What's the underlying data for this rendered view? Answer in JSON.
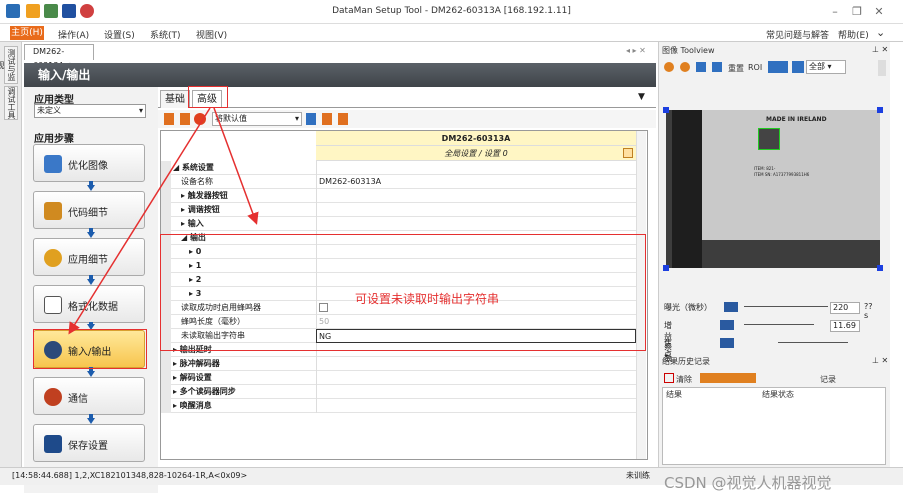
{
  "window": {
    "title": "DataMan Setup Tool - DM262-60313A [168.192.1.11]"
  },
  "menu": {
    "main": "主页(H)",
    "items": [
      "操作(A)",
      "设置(S)",
      "系统(T)",
      "视图(V)"
    ],
    "right": [
      "常见问题与解答",
      "帮助(E)"
    ]
  },
  "vtabs": [
    "测试与监视",
    "调试工具"
  ],
  "doc_tab": "DM262-60313A",
  "header": "输入/输出",
  "left": {
    "app_type_label": "应用类型",
    "app_type_value": "未定义",
    "steps_label": "应用步骤",
    "steps": [
      "优化图像",
      "代码细节",
      "应用细节",
      "格式化数据",
      "输入/输出",
      "通信",
      "保存设置"
    ]
  },
  "subtabs": [
    "基础",
    "高级"
  ],
  "toolbar": {
    "default_label": "将默认值"
  },
  "grid": {
    "device": "DM262-60313A",
    "settings_label": "全局设置 / 设置 0",
    "rows": [
      {
        "name": "系统设置",
        "value": "",
        "cat": true,
        "level": 0
      },
      {
        "name": "设备名称",
        "value": "DM262-60313A",
        "cat": false,
        "level": 1
      },
      {
        "name": "触发器按钮",
        "value": "",
        "cat": true,
        "level": 1
      },
      {
        "name": "调谐按钮",
        "value": "",
        "cat": true,
        "level": 1
      },
      {
        "name": "输入",
        "value": "",
        "cat": true,
        "level": 1
      },
      {
        "name": "输出",
        "value": "",
        "cat": true,
        "level": 1
      },
      {
        "name": "0",
        "value": "",
        "cat": true,
        "level": 2
      },
      {
        "name": "1",
        "value": "",
        "cat": true,
        "level": 2
      },
      {
        "name": "2",
        "value": "",
        "cat": true,
        "level": 2
      },
      {
        "name": "3",
        "value": "",
        "cat": true,
        "level": 2
      },
      {
        "name": "读取成功时启用蜂鸣器",
        "value": "",
        "cat": false,
        "level": 1
      },
      {
        "name": "蜂鸣长度（毫秒）",
        "value": "50",
        "cat": false,
        "level": 1
      },
      {
        "name": "未读取输出字符串",
        "value": "NG",
        "cat": false,
        "level": 1
      },
      {
        "name": "输出延时",
        "value": "",
        "cat": true,
        "level": 0
      },
      {
        "name": "脉冲解码器",
        "value": "",
        "cat": true,
        "level": 0
      },
      {
        "name": "解码设置",
        "value": "",
        "cat": true,
        "level": 0
      },
      {
        "name": "多个读码器同步",
        "value": "",
        "cat": true,
        "level": 0
      },
      {
        "name": "唤醒消息",
        "value": "",
        "cat": true,
        "level": 0
      }
    ]
  },
  "annotation": "可设置未读取时输出字符串",
  "right": {
    "image_title": "图像 Toolview",
    "reset": "重置",
    "roi": "ROI",
    "all": "全部",
    "img_text": {
      "made": "MADE IN IRELAND",
      "item": "ITEM: 821-",
      "sn": "ITEM SN: A17377993811H6"
    },
    "exposure_label": "曝光（微秒）",
    "exposure_value": "220",
    "exposure_unit": "??s",
    "gain_label": "增益系数",
    "gain_value": "11.69",
    "focus_label": "焦点",
    "results_title": "结果历史记录",
    "clear": "清除",
    "record": "记录",
    "col_result": "结果",
    "col_status": "结果状态"
  },
  "status": {
    "left": "[14:58:44.688] 1,2,XC182101348,828-10264-1R,A<0x09>",
    "right": "未训练"
  },
  "watermark": "CSDN @视觉人机器视觉",
  "colors": {
    "accent": "#e96b1b",
    "red": "#e53030",
    "blue": "#1c5cad"
  }
}
